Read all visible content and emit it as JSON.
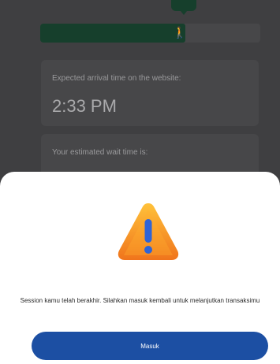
{
  "queue": {
    "progress_fraction": 0.66,
    "walker_icon": "person-walking-icon",
    "arrival_label": "Expected arrival time on the website:",
    "arrival_time": "2:33 PM",
    "wait_label": "Your estimated wait time is:",
    "wait_value": ""
  },
  "session_modal": {
    "icon": "warning-icon",
    "message": "Session kamu telah berakhir. Silahkan masuk kembali untuk melanjutkan transaksimu",
    "button_label": "Masuk"
  },
  "colors": {
    "overlay_background": "#3f3f41",
    "progress_fill": "#163f2c",
    "primary_button": "#1c4fa3",
    "warning_orange": "#f39a22"
  }
}
